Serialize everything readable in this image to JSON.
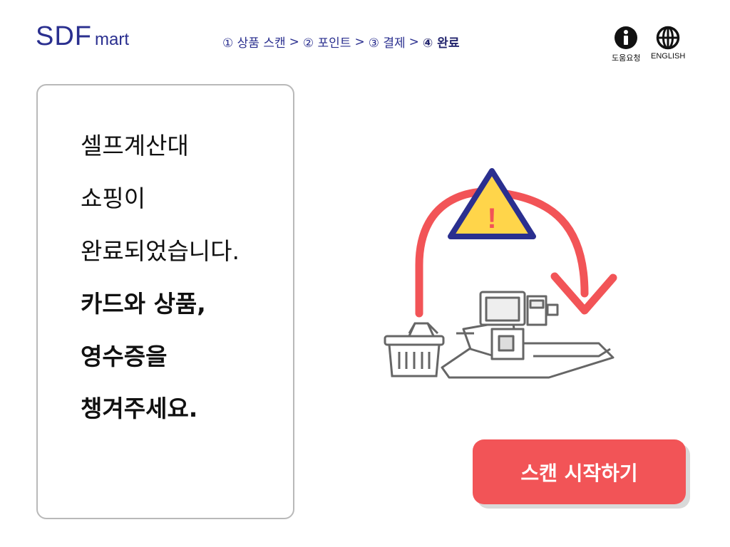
{
  "header": {
    "logo_main": "SDF",
    "logo_sub": "mart",
    "steps": [
      {
        "label": "① 상품 스캔"
      },
      {
        "label": "② 포인트"
      },
      {
        "label": "③ 결제"
      },
      {
        "label": "④ 완료"
      }
    ],
    "step_separator": ">",
    "current_step": 4,
    "help_label": "도움요청",
    "english_label": "ENGLISH"
  },
  "message": {
    "lines": [
      "셀프계산대",
      "쇼핑이",
      "완료되었습니다.",
      "카드와 상품,",
      "영수증을",
      "챙겨주세요."
    ]
  },
  "illustration": {
    "warning_mark": "!"
  },
  "scan_button": {
    "label": "스캔 시작하기"
  },
  "colors": {
    "brand": "#2a2f8f",
    "button": "#f25457",
    "arrow": "#f25457",
    "warning_fill": "#ffd54a",
    "warning_border": "#2a2f8f"
  }
}
